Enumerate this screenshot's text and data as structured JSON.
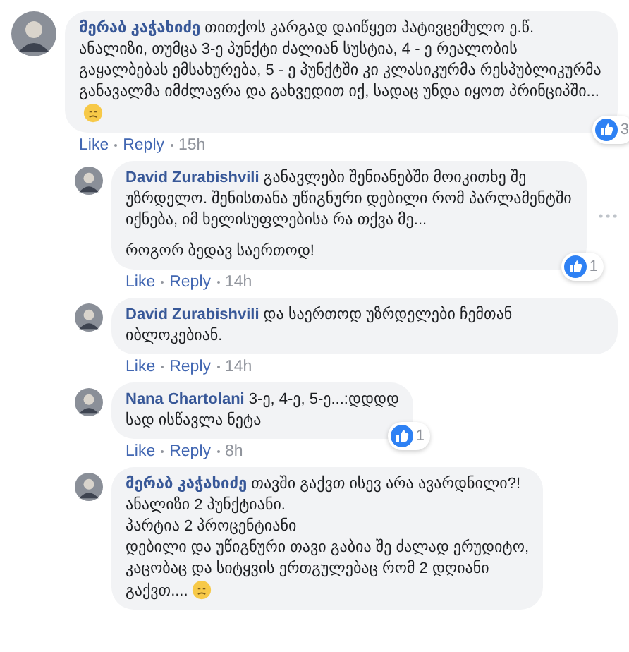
{
  "comments": [
    {
      "kind": "top",
      "author": "მერაბ კაჭახიძე",
      "paragraphs": [
        "თითქოს კარგად დაიწყეთ პატივცემულო ე.წ. ანალიზი, თუმცა 3-ე პუნქტი ძალიან სუსტია, 4 - ე რეალობის გაყალბებას ემსახურება, 5 - ე პუნქტში კი კლასიკურმა რესპუბლიკურმა განავალმა იმძლავრა და გახვედით იქ, სადაც უნდა იყოთ პრინციპში..."
      ],
      "emoji": true,
      "reactions": "3",
      "actions": [
        "Like",
        "Reply"
      ],
      "time": "15h"
    },
    {
      "kind": "reply",
      "author": "David Zurabishvili",
      "paragraphs": [
        "განავლები შენიანებში მოიკითხე შე უზრდელო. შენისთანა უწიგნური დებილი რომ პარლამენტში იქნება, იმ ხელისუფლებისა რა თქვა მე...",
        "როგორ ბედავ საერთოდ!"
      ],
      "reactions": "1",
      "actions": [
        "Like",
        "Reply"
      ],
      "time": "14h",
      "more": true
    },
    {
      "kind": "reply",
      "author": "David Zurabishvili",
      "paragraphs": [
        "და საერთოდ უზრდელები ჩემთან იბლოკებიან."
      ],
      "actions": [
        "Like",
        "Reply"
      ],
      "time": "14h"
    },
    {
      "kind": "reply",
      "author": "Nana Chartolani",
      "paragraphs": [
        "3-ე, 4-ე, 5-ე...:დდდდ\nსად ისწავლა ნეტა"
      ],
      "reactions": "1",
      "actions": [
        "Like",
        "Reply"
      ],
      "time": "8h"
    },
    {
      "kind": "reply",
      "author": "მერაბ კაჭახიძე",
      "paragraphs": [
        "თავში გაქვთ ისევ არა ავარდნილი?!\nანალიზი 2 პუნქტიანი.\nპარტია 2 პროცენტიანი\nდებილი და უწიგნური თავი გაბია შე ძალად ერუდიტო,\nკაცობაც და სიტყვის ერთგულებაც რომ 2 დღიანი\nგაქვთ...."
      ],
      "emoji": true
    }
  ]
}
